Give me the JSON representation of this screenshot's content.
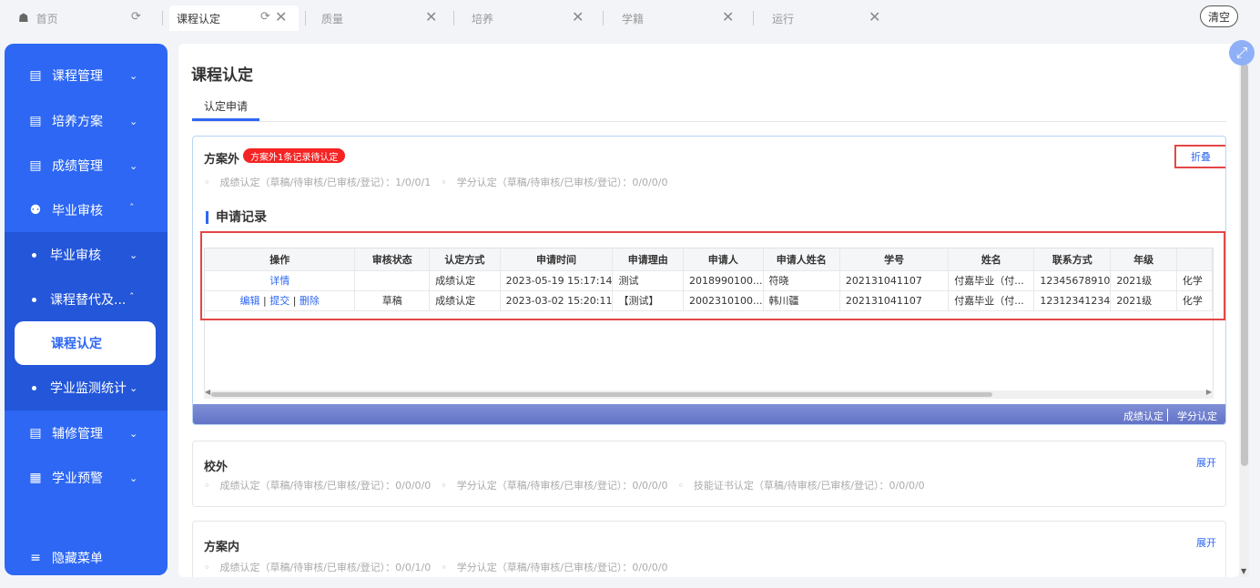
{
  "tabs": [
    {
      "label": "首页",
      "icon": "home-icon",
      "action": "refresh"
    },
    {
      "label": "课程认定",
      "active": true,
      "action": "refresh-close"
    },
    {
      "label": "质量",
      "action": "close"
    },
    {
      "label": "培养",
      "action": "close"
    },
    {
      "label": "学籍",
      "action": "close"
    },
    {
      "label": "运行",
      "action": "close"
    }
  ],
  "clear_label": "清空",
  "sidebar": {
    "items": [
      {
        "label": "课程管理"
      },
      {
        "label": "培养方案"
      },
      {
        "label": "成绩管理"
      },
      {
        "label": "毕业审核"
      },
      {
        "label": "毕业审核"
      },
      {
        "label": "课程替代及..."
      },
      {
        "label": "课程认定"
      },
      {
        "label": "学业监测统计"
      },
      {
        "label": "辅修管理"
      },
      {
        "label": "学业预警"
      }
    ],
    "hide_label": "隐藏菜单"
  },
  "page": {
    "title": "课程认定",
    "subtab": "认定申请"
  },
  "card1": {
    "title": "方案外",
    "badge": "方案外1条记录待认定",
    "fold_label": "折叠",
    "stats": "成绩认定（草稿/待审核/已审核/登记）：1/0/0/1　◦　学分认定（草稿/待审核/已审核/登记）：0/0/0/0",
    "records_title": "申请记录",
    "columns": [
      "操作",
      "审核状态",
      "认定方式",
      "申请时间",
      "申请理由",
      "申请人",
      "申请人姓名",
      "学号",
      "姓名",
      "联系方式",
      "年级",
      ""
    ],
    "rows": [
      {
        "actions": [
          "详情"
        ],
        "status": "",
        "method": "成绩认定",
        "time": "2023-05-19 15:17:14",
        "reason": "测试",
        "applicant": "2018990100...",
        "applicant_name": "符晓",
        "student_id": "202131041107",
        "name": "付嘉毕业（付...",
        "contact": "12345678910",
        "grade": "2021级",
        "extra": "化学"
      },
      {
        "actions": [
          "编辑",
          "提交",
          "删除"
        ],
        "status": "草稿",
        "method": "成绩认定",
        "time": "2023-03-02 15:20:11",
        "reason": "【测试】",
        "applicant": "2002310100...",
        "applicant_name": "韩川疆",
        "student_id": "202131041107",
        "name": "付嘉毕业（付...",
        "contact": "12312341234",
        "grade": "2021级",
        "extra": "化学"
      }
    ],
    "footer_buttons": [
      "成绩认定",
      "学分认定"
    ]
  },
  "card2": {
    "title": "校外",
    "expand_label": "展开",
    "stats": "成绩认定（草稿/待审核/已审核/登记）：0/0/0/0　◦　学分认定（草稿/待审核/已审核/登记）：0/0/0/0　◦　技能证书认定（草稿/待审核/已审核/登记）：0/0/0/0"
  },
  "card3": {
    "title": "方案内",
    "expand_label": "展开",
    "stats": "成绩认定（草稿/待审核/已审核/登记）：0/0/1/0　◦　学分认定（草稿/待审核/已审核/登记）：0/0/0/0"
  }
}
